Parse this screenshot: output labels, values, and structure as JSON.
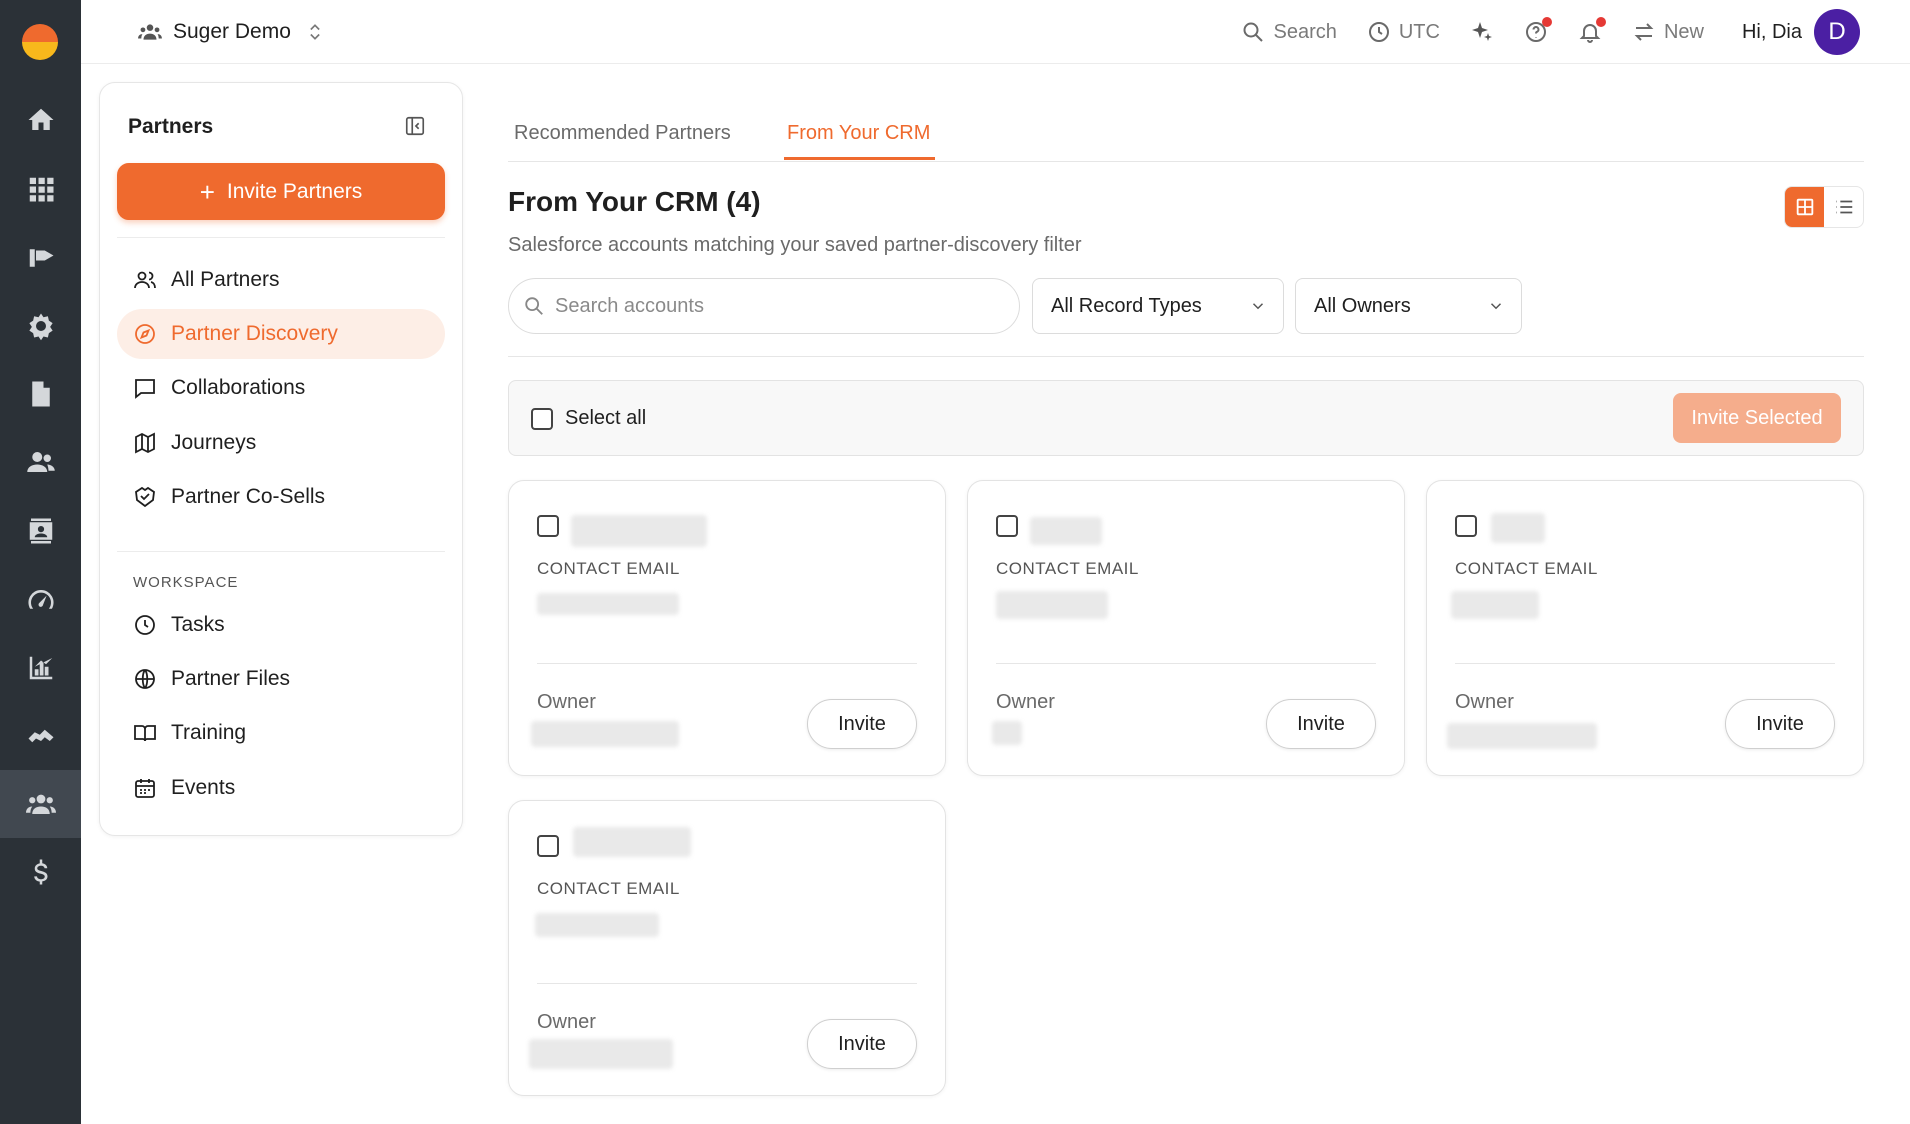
{
  "topbar": {
    "workspace_name": "Suger Demo",
    "search_label": "Search",
    "timezone_label": "UTC",
    "new_label": "New",
    "greeting": "Hi, Dia",
    "avatar_initial": "D"
  },
  "sidebar": {
    "title": "Partners",
    "invite_button_label": "Invite Partners",
    "items": [
      {
        "label": "All Partners",
        "icon": "users-icon"
      },
      {
        "label": "Partner Discovery",
        "icon": "compass-icon",
        "active": true
      },
      {
        "label": "Collaborations",
        "icon": "chat-icon"
      },
      {
        "label": "Journeys",
        "icon": "map-icon"
      },
      {
        "label": "Partner Co-Sells",
        "icon": "handshake-icon"
      }
    ],
    "workspace_label": "WORKSPACE",
    "workspace_items": [
      {
        "label": "Tasks",
        "icon": "clock-icon"
      },
      {
        "label": "Partner Files",
        "icon": "globe-icon"
      },
      {
        "label": "Training",
        "icon": "book-icon"
      },
      {
        "label": "Events",
        "icon": "calendar-icon"
      }
    ]
  },
  "tabs": [
    {
      "label": "Recommended Partners"
    },
    {
      "label": "From Your CRM",
      "active": true
    }
  ],
  "main": {
    "heading": "From Your CRM (4)",
    "subheading": "Salesforce accounts matching your saved partner-discovery filter",
    "search_placeholder": "Search accounts",
    "record_type_filter": "All Record Types",
    "owner_filter": "All Owners",
    "select_all_label": "Select all",
    "invite_selected_label": "Invite Selected"
  },
  "cards": [
    {
      "contact_label": "CONTACT EMAIL",
      "owner_label": "Owner",
      "invite_label": "Invite"
    },
    {
      "contact_label": "CONTACT EMAIL",
      "owner_label": "Owner",
      "invite_label": "Invite"
    },
    {
      "contact_label": "CONTACT EMAIL",
      "owner_label": "Owner",
      "invite_label": "Invite"
    },
    {
      "contact_label": "CONTACT EMAIL",
      "owner_label": "Owner",
      "invite_label": "Invite"
    }
  ],
  "colors": {
    "accent": "#ef6a2e",
    "rail_bg": "#2b3137",
    "avatar_bg": "#4b1fa3",
    "notification_dot": "#e53935"
  }
}
